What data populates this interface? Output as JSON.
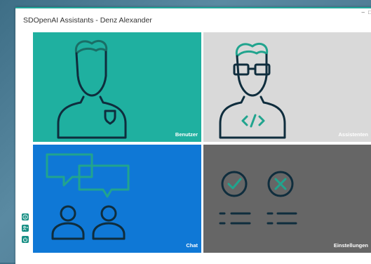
{
  "window": {
    "title": "SDOpenAI Assistants  -  Denz Alexander",
    "minimize_glyph": "‒",
    "maximize_glyph": "□"
  },
  "tiles": [
    {
      "label": "Benutzer",
      "color": "#1fb0a0",
      "icon": "user-icon"
    },
    {
      "label": "Assistenten",
      "color": "#d9d9d9",
      "icon": "developer-icon"
    },
    {
      "label": "Chat",
      "color": "#0f78d6",
      "icon": "chat-icon"
    },
    {
      "label": "Einstellungen",
      "color": "#666666",
      "icon": "settings-checklist-icon"
    }
  ],
  "sidebar": {
    "icons": [
      "info-icon",
      "user-switch-icon",
      "power-icon"
    ],
    "color": "#178f84"
  },
  "colors": {
    "icon_dark": "#0f2d3d",
    "icon_teal": "#21a48e"
  }
}
